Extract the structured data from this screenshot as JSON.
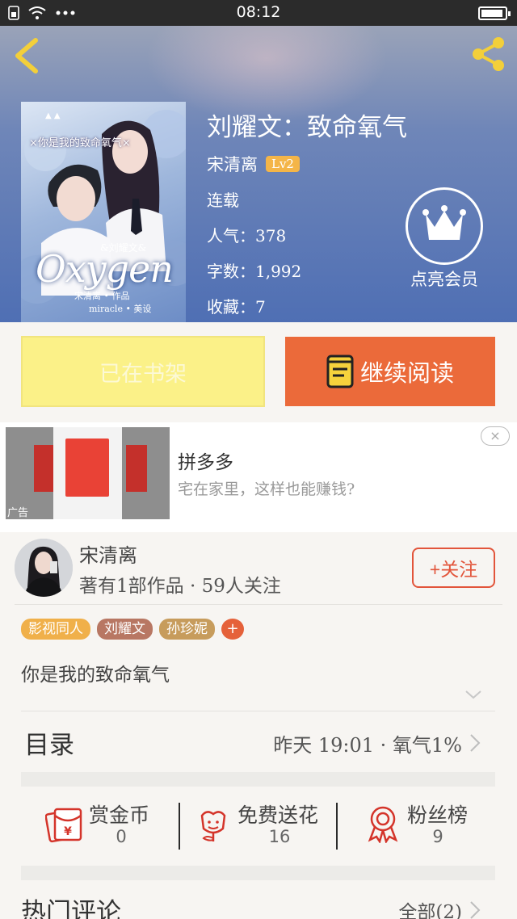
{
  "status_bar": {
    "time": "08:12",
    "battery_level": 0.92
  },
  "book": {
    "title": "刘耀文：致命氧气",
    "author": "宋清离",
    "author_level": "Lv2",
    "status": "连载",
    "popularity": "人气：378",
    "word_count": "字数：1,992",
    "favorites": "收藏：7"
  },
  "cover": {
    "title": "×你是我的致命氧气×",
    "big_text": "Oxygen",
    "sub1": "&刘耀文&",
    "sub2": "宋清离 • 作品",
    "sub3": "miracle • 美设"
  },
  "vip": {
    "label": "点亮会员",
    "icon": "crown-icon"
  },
  "actions": {
    "shelf_label": "已在书架",
    "read_label": "继续阅读"
  },
  "ad": {
    "title": "拼多多",
    "description": "宅在家里，这样也能赚钱?",
    "tag": "广告",
    "close": "×"
  },
  "author_card": {
    "name": "宋清离",
    "stats": "著有1部作品 · 59人关注",
    "follow_label": "+关注"
  },
  "tags": [
    {
      "label": "影视同人",
      "color": "#f0b04a"
    },
    {
      "label": "刘耀文",
      "color": "#b87763"
    },
    {
      "label": "孙珍妮",
      "color": "#c79c5c"
    }
  ],
  "tag_add": "+",
  "intro": "你是我的致命氧气",
  "toc": {
    "label": "目录",
    "info": "昨天 19:01 · 氧气1%"
  },
  "stats": [
    {
      "label": "赏金币",
      "value": "0",
      "icon": "red-envelope-icon"
    },
    {
      "label": "免费送花",
      "value": "16",
      "icon": "flower-icon"
    },
    {
      "label": "粉丝榜",
      "value": "9",
      "icon": "medal-icon"
    }
  ],
  "hot_comments": {
    "label": "热门评论",
    "all": "全部(2)"
  },
  "colors": {
    "accent": "#eb6a3a",
    "shelf": "#fbf188",
    "follow": "#e2553b",
    "icon_red": "#d4342a"
  }
}
